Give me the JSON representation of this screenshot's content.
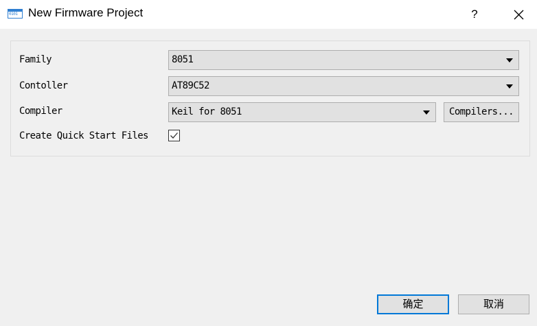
{
  "window": {
    "title": "New Firmware Project",
    "icon": "binary-app-icon",
    "icon_text": "0101",
    "help_label": "?",
    "close_icon": "close-icon"
  },
  "form": {
    "family": {
      "label": "Family",
      "value": "8051"
    },
    "controller": {
      "label": "Contoller",
      "value": "AT89C52"
    },
    "compiler": {
      "label": "Compiler",
      "value": "Keil for 8051",
      "button_label": "Compilers..."
    },
    "quick_start": {
      "label": "Create Quick Start Files",
      "checked": true
    }
  },
  "footer": {
    "ok_label": "确定",
    "cancel_label": "取消"
  },
  "colors": {
    "accent": "#0078d7",
    "background": "#f0f0f0",
    "control": "#e1e1e1"
  }
}
